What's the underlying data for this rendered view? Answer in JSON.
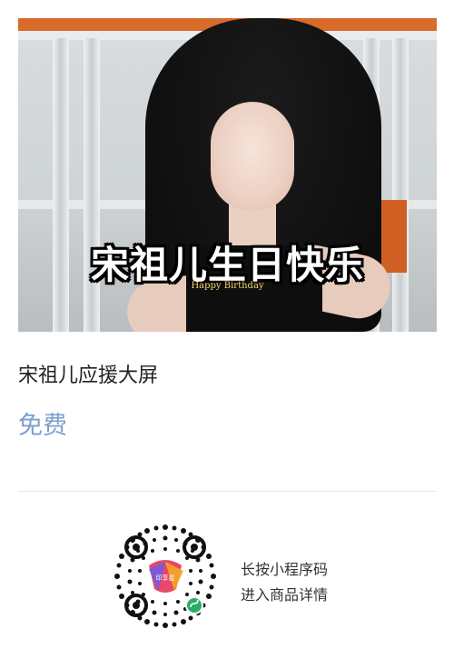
{
  "banner": {
    "title": "宋祖儿生日快乐",
    "subtitle": "Happy Birthday"
  },
  "product": {
    "title": "宋祖儿应援大屏",
    "price": "免费"
  },
  "qr": {
    "logo_text": "印享星",
    "hint_line1": "长按小程序码",
    "hint_line2": "进入商品详情"
  },
  "colors": {
    "price": "#7c9fd1",
    "banner_sub": "#f3d86a"
  }
}
